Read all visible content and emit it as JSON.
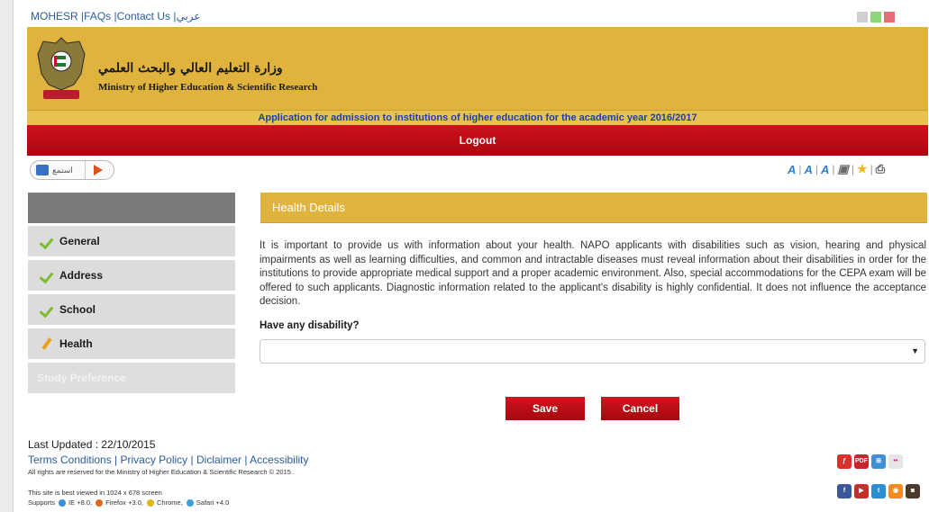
{
  "top_links": {
    "mohesr": "MOHESR",
    "faqs": "FAQs",
    "contact": "Contact Us",
    "arabic": "عربي"
  },
  "swatch_colors": [
    "#cfcfcf",
    "#8ed67b",
    "#e46e78"
  ],
  "banner": {
    "ministry_ar": "وزارة التعليم العالي والبحث العلمي",
    "ministry_en": "Ministry of Higher Education & Scientific Research"
  },
  "app_title": "Application for admission to institutions of higher education for the academic year 2016/2017",
  "logout_label": "Logout",
  "listen_label": "استمع",
  "tool_icons": [
    "text-size-icon",
    "font-icon",
    "text-color-icon",
    "contrast-icon",
    "favorite-star-icon",
    "print-icon"
  ],
  "sidebar": {
    "items": [
      {
        "label": "General",
        "status": "completed"
      },
      {
        "label": "Address",
        "status": "completed"
      },
      {
        "label": "School",
        "status": "completed"
      },
      {
        "label": "Health",
        "status": "editing"
      },
      {
        "label": "Study Preference",
        "status": "disabled"
      }
    ]
  },
  "section": {
    "title": "Health Details",
    "description": "It is important to provide us with information about your health. NAPO applicants with disabilities such as vision, hearing and physical impairments as well as learning difficulties, and common and intractable diseases must reveal information about their disabilities in order for the institutions to provide appropriate medical support and a proper academic environment. Also, special accommodations for the CEPA exam will be offered to such applicants. Diagnostic information related to the applicant's disability is highly confidential. It does not influence the acceptance decision.",
    "question": "Have any disability?",
    "select_value": ""
  },
  "buttons": {
    "save": "Save",
    "cancel": "Cancel"
  },
  "footer": {
    "last_updated": "Last Updated : 22/10/2015",
    "links": [
      "Terms Conditions",
      "Privacy Policy",
      "Diclaimer",
      "Accessibility"
    ],
    "rights": "All rights are reserved for the Ministry of Higher Education & Scientific Research © 2015 .",
    "best_viewed": "This site is best viewed in 1024 x 678 screen",
    "supports_label": "Supports",
    "browsers": [
      "IE +8.0",
      "Firefox +3.0",
      "Chrome",
      "Safari +4.0"
    ]
  },
  "accent_colors": {
    "gold": "#dfb33d",
    "red": "#c40b14",
    "link_blue": "#2a5c9a"
  }
}
